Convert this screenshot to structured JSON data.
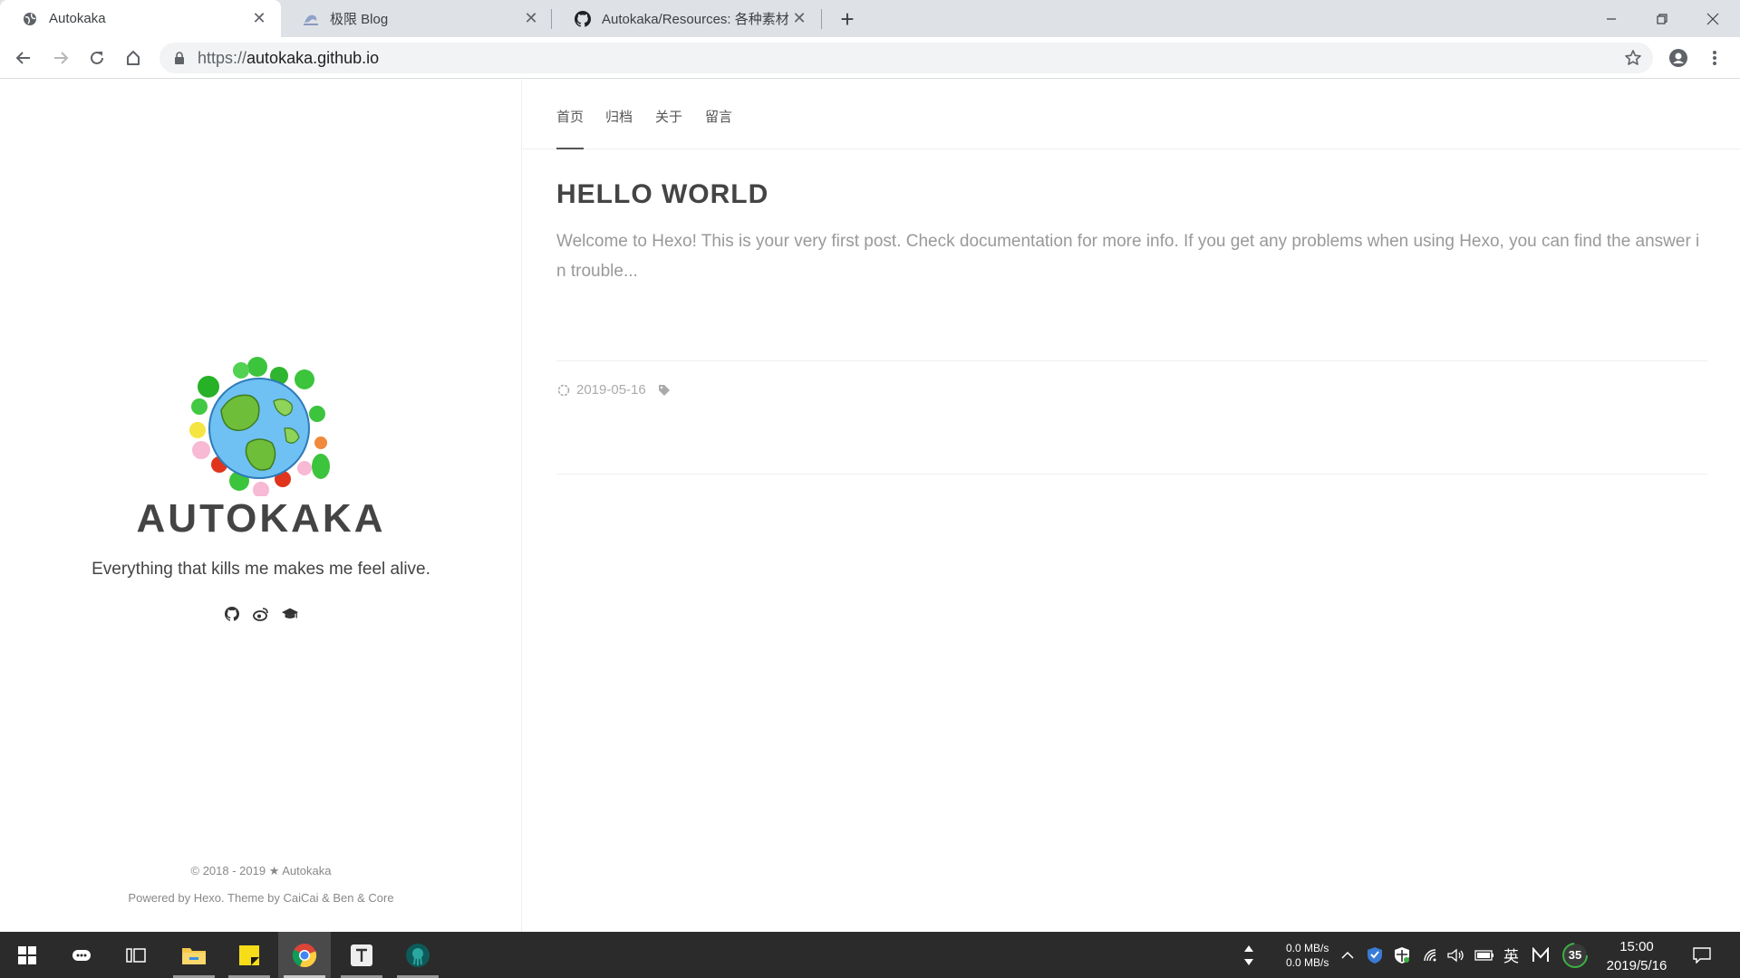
{
  "browser": {
    "tabs": [
      {
        "title": "Autokaka",
        "active": true
      },
      {
        "title": "极限 Blog",
        "active": false
      },
      {
        "title": "Autokaka/Resources: 各种素材",
        "active": false
      }
    ],
    "url_protocol": "https://",
    "url_host": "autokaka.github.io"
  },
  "sidebar": {
    "site_title": "AUTOKAKA",
    "description": "Everything that kills me makes me feel alive.",
    "social_icons": [
      "github-icon",
      "weibo-icon",
      "graduation-cap-icon"
    ],
    "footer_line1": "© 2018 - 2019 ★ Autokaka",
    "footer_powered_prefix": "Powered by ",
    "footer_hexo": "Hexo",
    "footer_theme_text": ". Theme by ",
    "footer_theme_link": "CaiCai & Ben & Core"
  },
  "nav": {
    "items": [
      {
        "label": "首页",
        "active": true
      },
      {
        "label": "归档",
        "active": false
      },
      {
        "label": "关于",
        "active": false
      },
      {
        "label": "留言",
        "active": false
      }
    ]
  },
  "post": {
    "title": "HELLO WORLD",
    "excerpt": "Welcome to Hexo! This is your very first post. Check documentation for more info. If you get any problems when using Hexo, you can find the answer in trouble...",
    "date": "2019-05-16"
  },
  "taskbar": {
    "net_up": "0.0 MB/s",
    "net_down": "0.0 MB/s",
    "ime": "英",
    "badge": "35",
    "time": "15:00",
    "date": "2019/5/16"
  },
  "colors": {
    "chrome_tabbar": "#dee1e6",
    "text_main": "#444444",
    "text_muted": "#999999",
    "taskbar": "#2b2b2b"
  }
}
